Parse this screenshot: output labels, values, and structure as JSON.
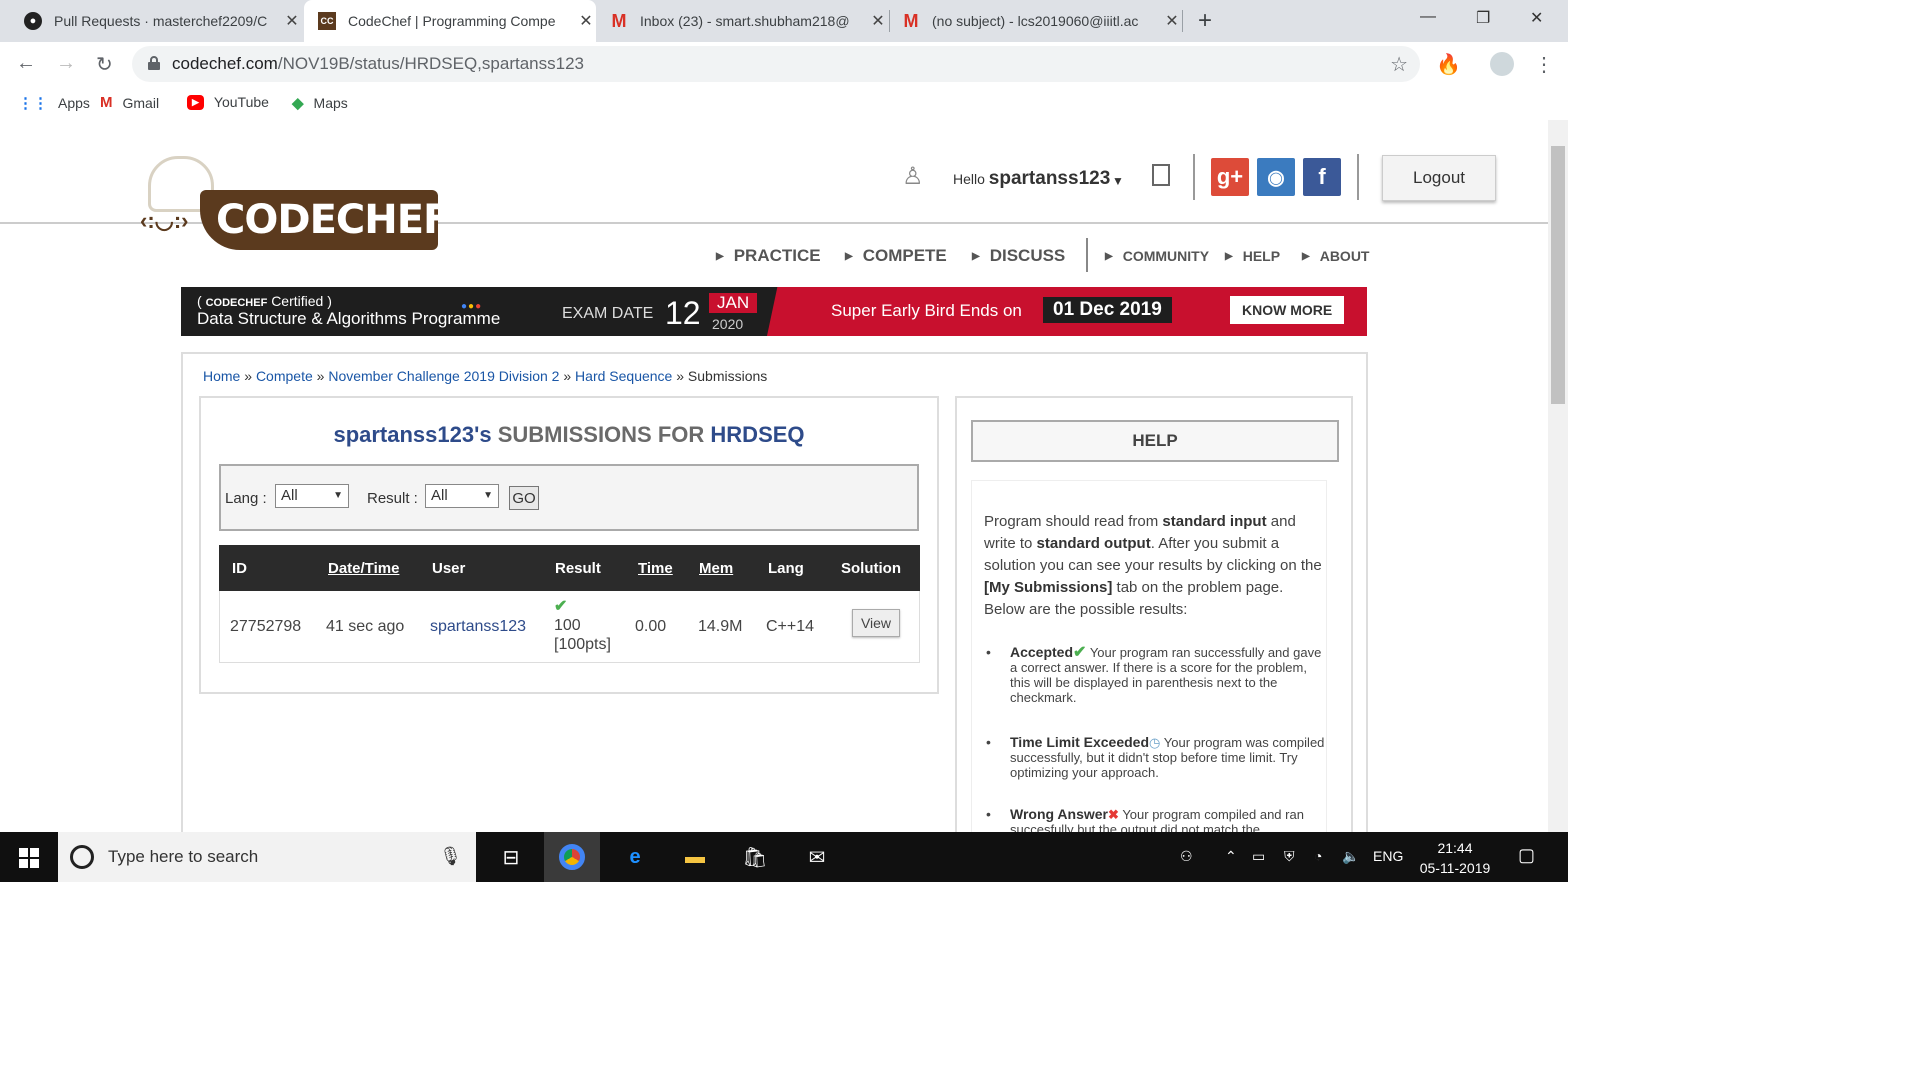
{
  "browser": {
    "tabs": [
      {
        "title": "Pull Requests · masterchef2209/C",
        "icon": "github-icon"
      },
      {
        "title": "CodeChef | Programming Compe",
        "icon": "codechef-icon"
      },
      {
        "title": "Inbox (23) - smart.shubham218@",
        "icon": "gmail-icon"
      },
      {
        "title": "(no subject) - lcs2019060@iiitl.ac",
        "icon": "gmail-icon"
      }
    ],
    "url_host": "codechef.com",
    "url_path": "/NOV19B/status/HRDSEQ,spartanss123",
    "bookmarks": [
      "Apps",
      "Gmail",
      "YouTube",
      "Maps"
    ]
  },
  "header": {
    "logo_text": "CODECHEF",
    "hello_prefix": "Hello",
    "username": "spartanss123",
    "logout": "Logout",
    "social": [
      "g+",
      "github",
      "f"
    ]
  },
  "nav": {
    "main": [
      "PRACTICE",
      "COMPETE",
      "DISCUSS"
    ],
    "secondary": [
      "COMMUNITY",
      "HELP",
      "ABOUT"
    ]
  },
  "banner": {
    "brand": "CODECHEF",
    "certified": "Certified",
    "programme": "Data Structure & Algorithms Programme",
    "exam_label": "EXAM DATE",
    "exam_day": "12",
    "exam_month": "JAN",
    "exam_year": "2020",
    "early_bird": "Super Early Bird Ends on",
    "early_date": "01 Dec 2019",
    "cta": "KNOW MORE"
  },
  "breadcrumb": {
    "links": [
      "Home",
      "Compete",
      "November Challenge 2019 Division 2",
      "Hard Sequence"
    ],
    "current": "Submissions",
    "sep": "»"
  },
  "submissions": {
    "title_user": "spartanss123's",
    "title_mid": "SUBMISSIONS FOR",
    "title_code": "HRDSEQ",
    "lang_label": "Lang :",
    "lang_value": "All",
    "result_label": "Result :",
    "result_value": "All",
    "go": "GO",
    "columns": [
      "ID",
      "Date/Time",
      "User",
      "Result",
      "Time",
      "Mem",
      "Lang",
      "Solution"
    ],
    "row": {
      "id": "27752798",
      "datetime": "41 sec ago",
      "user": "spartanss123",
      "result_score": "100",
      "result_pts": "[100pts]",
      "time": "0.00",
      "mem": "14.9M",
      "lang": "C++14",
      "view": "View"
    }
  },
  "help": {
    "title": "HELP",
    "intro_1": "Program should read from",
    "intro_b1": "standard input",
    "intro_2": "and write to",
    "intro_b2": "standard output",
    "intro_3": ". After you submit a solution you can see your results by clicking on the",
    "intro_b3": "[My Submissions]",
    "intro_4": "tab on the problem page. Below are the possible results:",
    "items": [
      {
        "name": "Accepted",
        "desc": "Your program ran successfully and gave a correct answer. If there is a score for the problem, this will be displayed in parenthesis next to the checkmark."
      },
      {
        "name": "Time Limit Exceeded",
        "desc": "Your program was compiled successfully, but it didn't stop before time limit. Try optimizing your approach."
      },
      {
        "name": "Wrong Answer",
        "desc": "Your program compiled and ran succesfully but the output did not match the"
      }
    ]
  },
  "taskbar": {
    "search_placeholder": "Type here to search",
    "lang": "ENG",
    "time": "21:44",
    "date": "05-11-2019"
  }
}
